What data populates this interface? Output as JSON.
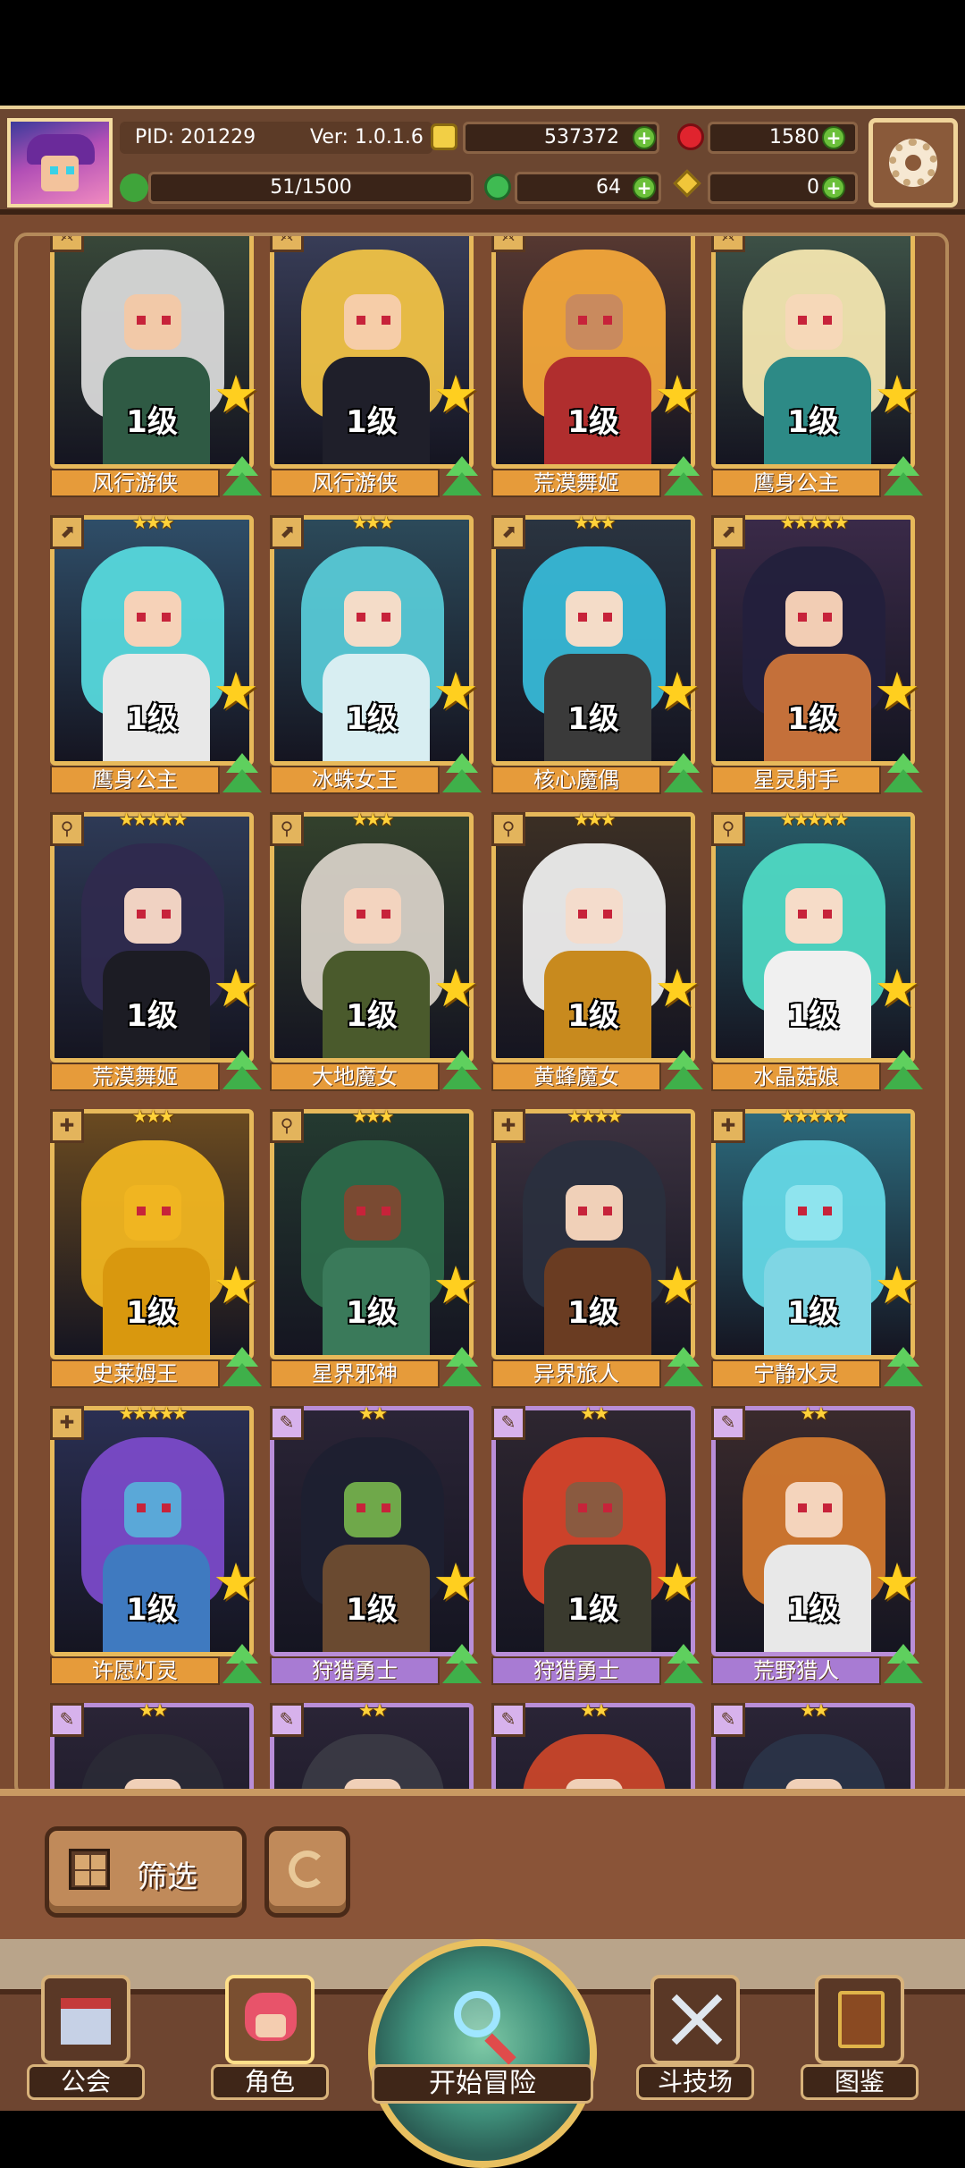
{
  "hud": {
    "pid": "PID: 201229",
    "version": "Ver: 1.0.1.6",
    "energy": "51/1500",
    "gold": "537372",
    "gems": "1580",
    "clover": "64",
    "keys": "0"
  },
  "cards": [
    {
      "name": "风行游侠",
      "level": "1级",
      "stars": "",
      "hair": "#d8d8d8",
      "skin": "#f2c9a8",
      "bg": "#3a4a3a",
      "outfit": "#2f5a44",
      "type": "⚔",
      "frame": "gold"
    },
    {
      "name": "风行游侠",
      "level": "1级",
      "stars": "",
      "hair": "#f0c246",
      "skin": "#f6cda8",
      "bg": "#3a3f5a",
      "outfit": "#1f1f2a",
      "type": "⚔",
      "frame": "gold"
    },
    {
      "name": "荒漠舞姬",
      "level": "1级",
      "stars": "",
      "hair": "#f2a63a",
      "skin": "#c98a5e",
      "bg": "#5a3a32",
      "outfit": "#b02e2e",
      "type": "⚔",
      "frame": "gold"
    },
    {
      "name": "鹰身公主",
      "level": "1级",
      "stars": "",
      "hair": "#f3e6b0",
      "skin": "#f6d8b8",
      "bg": "#3f5448",
      "outfit": "#2d8a86",
      "type": "⚔",
      "frame": "gold"
    },
    {
      "name": "鹰身公主",
      "level": "1级",
      "stars": "★★★",
      "hair": "#56d8dc",
      "skin": "#f6d2b8",
      "bg": "#2f4e68",
      "outfit": "#e8e8e8",
      "type": "⬈",
      "frame": "gold"
    },
    {
      "name": "冰蛛女王",
      "level": "1级",
      "stars": "★★★",
      "hair": "#57c9d6",
      "skin": "#f4dcc8",
      "bg": "#2c4a5a",
      "outfit": "#d8eef2",
      "type": "⬈",
      "frame": "gold"
    },
    {
      "name": "核心魔偶",
      "level": "1级",
      "stars": "★★★",
      "hair": "#37b8d6",
      "skin": "#f4dcc8",
      "bg": "#2a3440",
      "outfit": "#3a3a3a",
      "type": "⬈",
      "frame": "gold"
    },
    {
      "name": "星灵射手",
      "level": "1级",
      "stars": "★★★★★",
      "hair": "#23203c",
      "skin": "#f2cdb4",
      "bg": "#3a2a48",
      "outfit": "#c4703a",
      "type": "⬈",
      "frame": "gold"
    },
    {
      "name": "荒漠舞姬",
      "level": "1级",
      "stars": "★★★★★",
      "hair": "#2f2a4e",
      "skin": "#f0d2c2",
      "bg": "#2e3a56",
      "outfit": "#1c1c24",
      "type": "⚲",
      "frame": "gold"
    },
    {
      "name": "大地魔女",
      "level": "1级",
      "stars": "★★★",
      "hair": "#d6d0c6",
      "skin": "#f3d4bf",
      "bg": "#33412c",
      "outfit": "#4a5a2c",
      "type": "⚲",
      "frame": "gold"
    },
    {
      "name": "黄蜂魔女",
      "level": "1级",
      "stars": "★★★",
      "hair": "#ededed",
      "skin": "#f4dccc",
      "bg": "#3b2f24",
      "outfit": "#c88a1e",
      "type": "⚲",
      "frame": "gold"
    },
    {
      "name": "水晶菇娘",
      "level": "1级",
      "stars": "★★★★★",
      "hair": "#4fd9c4",
      "skin": "#f6dcc8",
      "bg": "#275a66",
      "outfit": "#f0f0f0",
      "type": "⚲",
      "frame": "gold"
    },
    {
      "name": "史莱姆王",
      "level": "1级",
      "stars": "★★★",
      "hair": "#f0b521",
      "skin": "#f0b521",
      "bg": "#6a4a20",
      "outfit": "#d9980e",
      "type": "✚",
      "frame": "gold"
    },
    {
      "name": "星界邪神",
      "level": "1级",
      "stars": "★★★",
      "hair": "#2d6a4a",
      "skin": "#7a4a32",
      "bg": "#243a30",
      "outfit": "#3a7a5a",
      "type": "⚲",
      "frame": "gold"
    },
    {
      "name": "异界旅人",
      "level": "1级",
      "stars": "★★★★",
      "hair": "#2a2f3e",
      "skin": "#f0d0b8",
      "bg": "#3c3240",
      "outfit": "#6a3c22",
      "type": "✚",
      "frame": "gold"
    },
    {
      "name": "宁静水灵",
      "level": "1级",
      "stars": "★★★★★",
      "hair": "#64d8e6",
      "skin": "#8fe4ee",
      "bg": "#2c6a7c",
      "outfit": "#7fd6e4",
      "type": "✚",
      "frame": "gold"
    },
    {
      "name": "许愿灯灵",
      "level": "1级",
      "stars": "★★★★★",
      "hair": "#7a4ac8",
      "skin": "#5aa8d8",
      "bg": "#2a2f52",
      "outfit": "#3f7ac0",
      "type": "✚",
      "frame": "gold"
    },
    {
      "name": "狩猎勇士",
      "level": "1级",
      "stars": "★★",
      "hair": "#1e2030",
      "skin": "#6fa84a",
      "bg": "#2a2436",
      "outfit": "#6a4a30",
      "type": "✎",
      "frame": "purple"
    },
    {
      "name": "狩猎勇士",
      "level": "1级",
      "stars": "★★",
      "hair": "#d6442a",
      "skin": "#8a5a40",
      "bg": "#2e2630",
      "outfit": "#3a3a2e",
      "type": "✎",
      "frame": "purple"
    },
    {
      "name": "荒野猎人",
      "level": "1级",
      "stars": "★★",
      "hair": "#d2782e",
      "skin": "#f4d4bc",
      "bg": "#3a2a2c",
      "outfit": "#e8e8e8",
      "type": "✎",
      "frame": "purple"
    },
    {
      "name": "",
      "level": "",
      "stars": "★★",
      "hair": "#2a2a36",
      "skin": "#f0d0b8",
      "bg": "#2a2436",
      "outfit": "#333",
      "type": "✎",
      "frame": "purple"
    },
    {
      "name": "",
      "level": "",
      "stars": "★★",
      "hair": "#3a3a44",
      "skin": "#f0d0b8",
      "bg": "#2a2436",
      "outfit": "#333",
      "type": "✎",
      "frame": "purple"
    },
    {
      "name": "",
      "level": "",
      "stars": "★★",
      "hair": "#c8462a",
      "skin": "#f0d0b8",
      "bg": "#2a2436",
      "outfit": "#333",
      "type": "✎",
      "frame": "purple"
    },
    {
      "name": "",
      "level": "",
      "stars": "★★",
      "hair": "#2a3448",
      "skin": "#f0d0b8",
      "bg": "#2a2436",
      "outfit": "#333",
      "type": "✎",
      "frame": "purple"
    }
  ],
  "filter": {
    "label": "筛选"
  },
  "nav": {
    "guild": "公会",
    "character": "角色",
    "start": "开始冒险",
    "arena": "斗技场",
    "codex": "图鉴"
  }
}
